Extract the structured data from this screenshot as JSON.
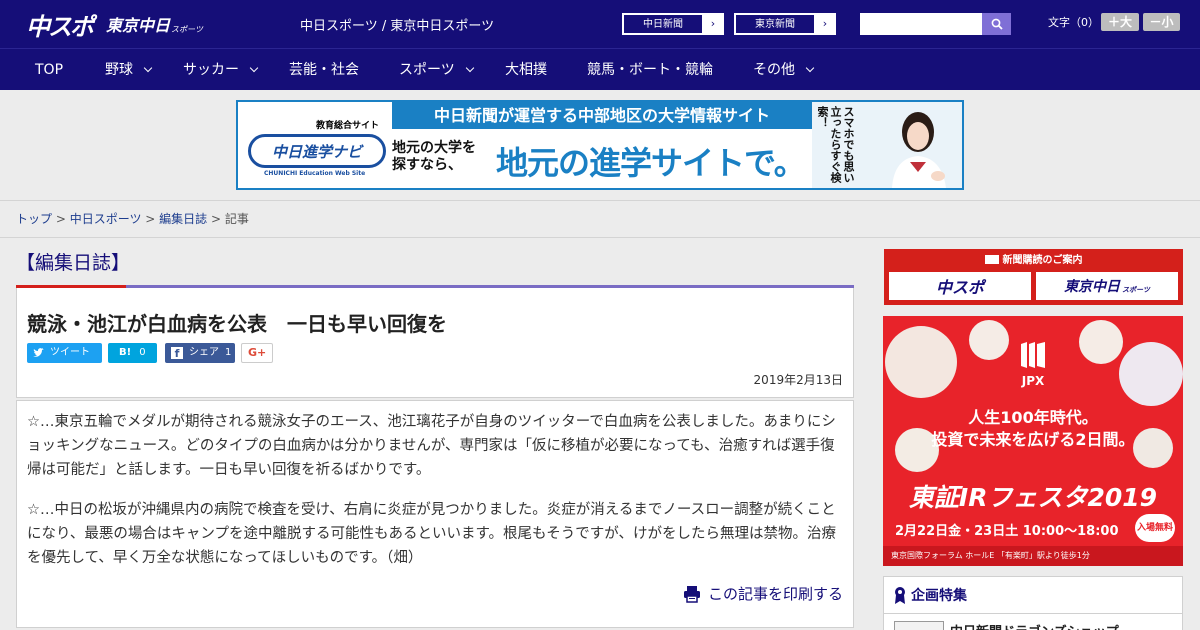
{
  "header": {
    "logo_main": "中スポ",
    "logo_sub": "東京中日",
    "logo_sub_small": "スポーツ",
    "site_desc": "中日スポーツ / 東京中日スポーツ",
    "ext_links": [
      "中日新聞",
      "東京新聞"
    ],
    "search_placeholder": "",
    "font_label": "文字（0）",
    "font_larger": "＋大",
    "font_smaller": "－小"
  },
  "nav": {
    "items": [
      {
        "label": "TOP",
        "dropdown": false
      },
      {
        "label": "野球",
        "dropdown": true
      },
      {
        "label": "サッカー",
        "dropdown": true
      },
      {
        "label": "芸能・社会",
        "dropdown": false
      },
      {
        "label": "スポーツ",
        "dropdown": true
      },
      {
        "label": "大相撲",
        "dropdown": false
      },
      {
        "label": "競馬・ボート・競輪",
        "dropdown": false
      },
      {
        "label": "その他",
        "dropdown": true
      }
    ]
  },
  "banner": {
    "headline": "中日新聞が運営する中部地区の大学情報サイト",
    "badge": "教育総合サイト",
    "logo_text": "中日進学ナビ",
    "logo_caption": "CHUNICHI Education Web Site",
    "sub_line1": "地元の大学を",
    "sub_line2": "探すなら、",
    "main": "地元の進学サイトで。",
    "vertical": "スマホでも思い立ったらすぐ検索！"
  },
  "breadcrumb": {
    "items": [
      "トップ",
      "中日スポーツ",
      "編集日誌"
    ],
    "current": "記事",
    "separator": " > "
  },
  "article": {
    "category": "【編集日誌】",
    "title": "競泳・池江が白血病を公表　一日も早い回復を",
    "share": {
      "tweet": "ツイート",
      "hatena": "B!",
      "hatena_count": "0",
      "fb": "シェア",
      "fb_count": "1",
      "gplus": "G+"
    },
    "date": "2019年2月13日",
    "paragraphs": [
      "☆…東京五輪でメダルが期待される競泳女子のエース、池江璃花子が自身のツイッターで白血病を公表しました。あまりにショッキングなニュース。どのタイプの白血病かは分かりませんが、専門家は「仮に移植が必要になっても、治癒すれば選手復帰は可能だ」と話します。一日も早い回復を祈るばかりです。",
      "☆…中日の松坂が沖縄県内の病院で検査を受け、右肩に炎症が見つかりました。炎症が消えるまでノースロー調整が続くことになり、最悪の場合はキャンプを途中離脱する可能性もあるといいます。根尾もそうですが、けがをしたら無理は禁物。治療を優先して、早く万全な状態になってほしいものです。（畑）"
    ],
    "print": "この記事を印刷する"
  },
  "sidebar": {
    "subscribe_title": "新聞購読のご案内",
    "subscribe_buttons": [
      "中スポ",
      "東京中日"
    ],
    "subscribe_small": "スポーツ",
    "ad": {
      "brand": "JPX",
      "line1": "人生100年時代。",
      "line2": "投資で未来を広げる2日間。",
      "event": "東証IRフェスタ2019",
      "dates": "2月22日金・23日土 10:00～18:00",
      "free": "入場無料",
      "venue": "東京国際フォーラム ホールE 「有楽町」駅より徒歩1分"
    },
    "feature_title": "企画特集",
    "feature_item": "中日新聞ドラゴンズショップ"
  },
  "colors": {
    "brand": "#150e78",
    "accent_red": "#d4201b",
    "banner_blue": "#1a80c4",
    "twitter": "#1da1f2",
    "hatena": "#00a4de",
    "facebook": "#3b5998"
  }
}
